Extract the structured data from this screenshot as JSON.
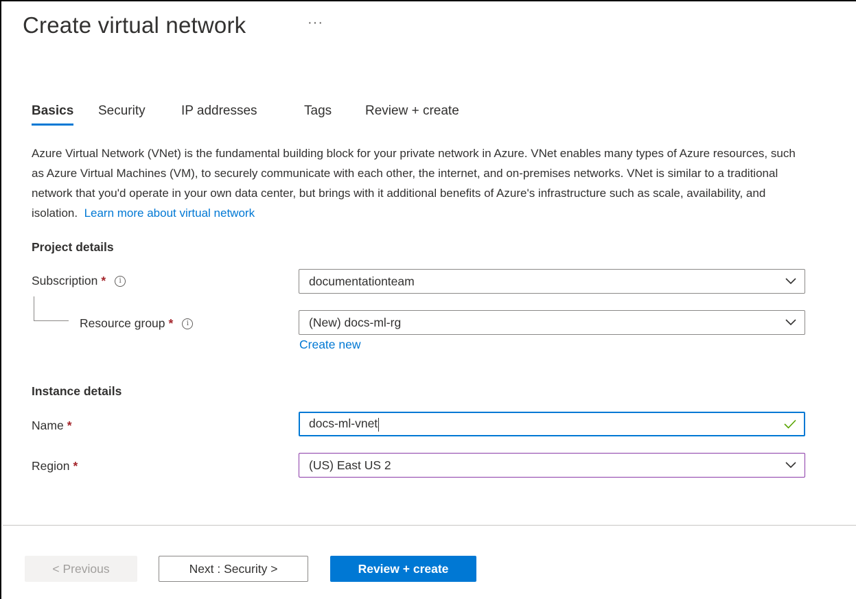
{
  "page": {
    "title": "Create virtual network",
    "more_glyph": "···"
  },
  "tabs": [
    {
      "label": "Basics",
      "active": true
    },
    {
      "label": "Security",
      "active": false
    },
    {
      "label": "IP addresses",
      "active": false
    },
    {
      "label": "Tags",
      "active": false
    },
    {
      "label": "Review + create",
      "active": false
    }
  ],
  "description": {
    "text": "Azure Virtual Network (VNet) is the fundamental building block for your private network in Azure. VNet enables many types of Azure resources, such as Azure Virtual Machines (VM), to securely communicate with each other, the internet, and on-premises networks. VNet is similar to a traditional network that you'd operate in your own data center, but brings with it additional benefits of Azure's infrastructure such as scale, availability, and isolation.",
    "link": "Learn more about virtual network"
  },
  "project_details": {
    "heading": "Project details",
    "subscription": {
      "label": "Subscription",
      "required": "*",
      "info": "i",
      "value": "documentationteam"
    },
    "resource_group": {
      "label": "Resource group",
      "required": "*",
      "info": "i",
      "value": "(New) docs-ml-rg",
      "create_new": "Create new"
    }
  },
  "instance_details": {
    "heading": "Instance details",
    "name": {
      "label": "Name",
      "required": "*",
      "value": "docs-ml-vnet"
    },
    "region": {
      "label": "Region",
      "required": "*",
      "value": "(US) East US 2"
    }
  },
  "footer": {
    "previous": "< Previous",
    "next": "Next : Security >",
    "review": "Review + create"
  },
  "colors": {
    "accent": "#0078d4",
    "required": "#a4262c",
    "valid_check": "#57a300",
    "region_border": "#8a3aa8"
  },
  "icons": {
    "more": "ellipsis-icon",
    "info": "info-icon",
    "dropdown": "chevron-down-icon",
    "valid": "checkmark-icon"
  }
}
